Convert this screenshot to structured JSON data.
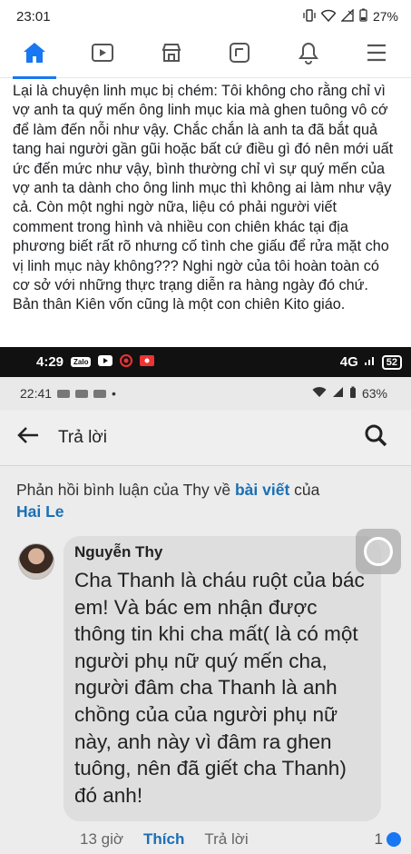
{
  "status_bar": {
    "time": "23:01",
    "battery": "27%",
    "icons": [
      "vibrate-icon",
      "wifi-icon",
      "no-signal-icon",
      "battery-icon"
    ]
  },
  "nav": {
    "items": [
      {
        "name": "home-icon",
        "active": true
      },
      {
        "name": "video-icon",
        "active": false
      },
      {
        "name": "marketplace-icon",
        "active": false
      },
      {
        "name": "groups-icon",
        "active": false
      },
      {
        "name": "notifications-icon",
        "active": false
      },
      {
        "name": "menu-icon",
        "active": false
      }
    ]
  },
  "post": {
    "text": "Lại là chuyện linh mục bị chém: Tôi không cho rằng chỉ vì vợ anh ta quý mến ông linh mục kia mà ghen tuông vô cớ để làm đến nỗi như vậy. Chắc chắn là anh ta đã bắt quả tang hai người gần gũi hoặc bất cứ điều gì đó nên mới uất ức đến mức như vậy, bình thường chỉ vì sự quý mến của vợ anh ta dành cho ông linh mục thì không ai làm như vậy cả. Còn một nghi ngờ nữa, liệu có phải người viết comment trong hình và nhiều con chiên khác tại địa phương biết rất rõ nhưng cố tình che giấu để rửa mặt cho vị linh mục này không??? Nghi ngờ của tôi hoàn toàn có cơ sở với những thực trạng diễn ra hàng ngày đó chứ. Bản thân Kiên vốn cũng là một con chiên Kito giáo."
  },
  "embedded_screenshot": {
    "status_bar": {
      "time": "4:29",
      "signal": "4G",
      "battery": "52"
    },
    "inner_status_bar": {
      "time": "22:41",
      "battery": "63%"
    },
    "header": {
      "title": "Trả lời"
    },
    "thread_title": {
      "prefix": "Phản hồi bình luận của Thy về ",
      "link": "bài viết",
      "middle": " của",
      "author_link": "Hai Le"
    },
    "comment": {
      "author": "Nguyễn Thy",
      "text": "Cha Thanh là cháu ruột của bác em! Và bác em nhận được thông tin khi cha mất( là có một người phụ nữ quý mến cha, người đâm cha Thanh là anh chồng của của người phụ nữ này, anh này vì đâm ra ghen tuông, nên đã giết cha Thanh) đó anh!",
      "time": "13 giờ",
      "like_label": "Thích",
      "reply_label": "Trả lời",
      "reaction_count": "1"
    }
  }
}
